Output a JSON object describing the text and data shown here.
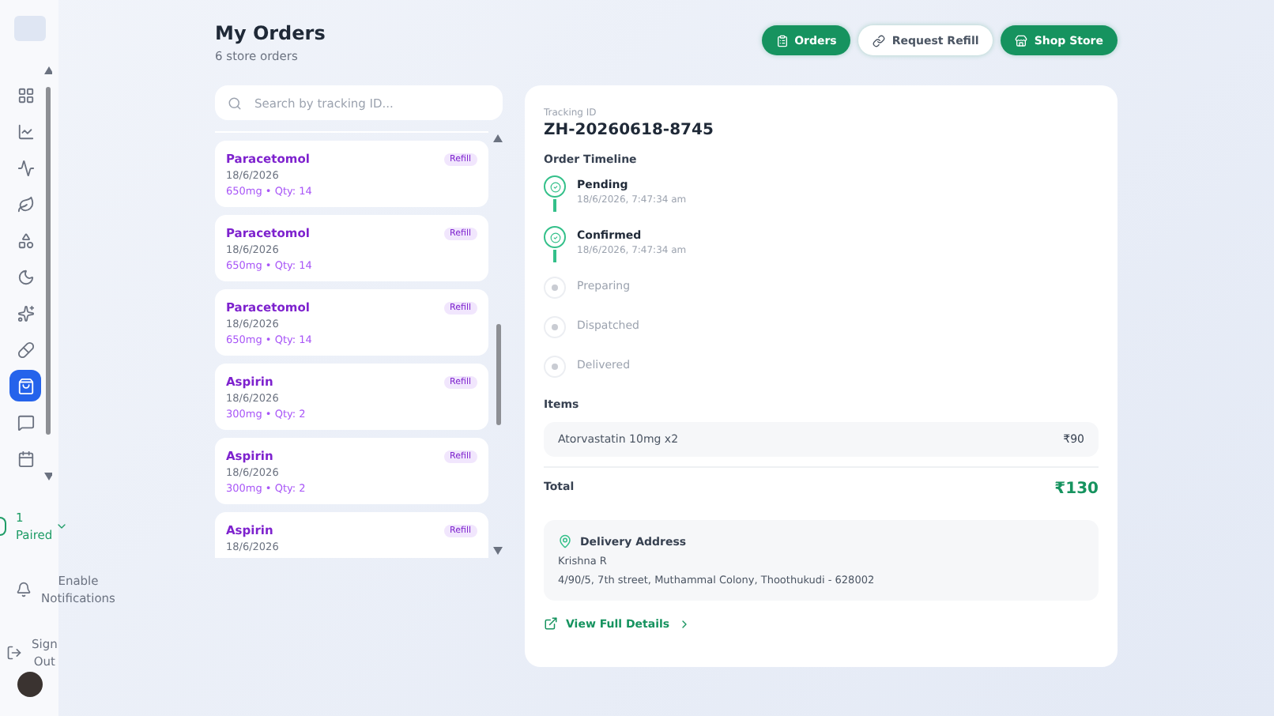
{
  "sidebar": {
    "nav_items": [
      {
        "selected": false
      },
      {
        "selected": false
      },
      {
        "selected": false
      },
      {
        "selected": false
      },
      {
        "selected": false
      },
      {
        "selected": false
      },
      {
        "selected": false
      },
      {
        "selected": false
      },
      {
        "selected": true
      },
      {
        "selected": false
      },
      {
        "selected": false
      }
    ],
    "paired": {
      "count": "1",
      "label": "Paired"
    },
    "notifications": {
      "label": "Enable Notifications"
    },
    "sign_out": {
      "label": "Sign Out"
    }
  },
  "header": {
    "title": "My Orders",
    "subtitle": "6 store orders",
    "buttons": [
      {
        "label": "Orders",
        "kind": "primary"
      },
      {
        "label": "Request Refill",
        "kind": "secondary"
      },
      {
        "label": "Shop Store",
        "kind": "primary"
      }
    ]
  },
  "search": {
    "placeholder": "Search by tracking ID..."
  },
  "orders": [
    {
      "name": "Paracetomol",
      "badge": "Refill",
      "date": "18/6/2026",
      "detail": "650mg • Qty: 14"
    },
    {
      "name": "Paracetomol",
      "badge": "Refill",
      "date": "18/6/2026",
      "detail": "650mg • Qty: 14"
    },
    {
      "name": "Paracetomol",
      "badge": "Refill",
      "date": "18/6/2026",
      "detail": "650mg • Qty: 14"
    },
    {
      "name": "Aspirin",
      "badge": "Refill",
      "date": "18/6/2026",
      "detail": "300mg • Qty: 2"
    },
    {
      "name": "Aspirin",
      "badge": "Refill",
      "date": "18/6/2026",
      "detail": "300mg • Qty: 2"
    },
    {
      "name": "Aspirin",
      "badge": "Refill",
      "date": "18/6/2026"
    }
  ],
  "detail": {
    "tracking_label": "Tracking ID",
    "tracking_id": "ZH-20260618-8745",
    "timeline_title": "Order Timeline",
    "timeline": [
      {
        "status": "Pending",
        "time": "18/6/2026, 7:47:34 am",
        "done": true
      },
      {
        "status": "Confirmed",
        "time": "18/6/2026, 7:47:34 am",
        "done": true
      },
      {
        "status": "Preparing",
        "done": false
      },
      {
        "status": "Dispatched",
        "done": false
      },
      {
        "status": "Delivered",
        "done": false
      }
    ],
    "items_title": "Items",
    "items": [
      {
        "name": "Atorvastatin 10mg x2",
        "price": "₹90"
      }
    ],
    "total_label": "Total",
    "total": "₹130",
    "address": {
      "title": "Delivery Address",
      "name": "Krishna R",
      "line": "4/90/5, 7th street, Muthammal Colony, Thoothukudi - 628002"
    },
    "link": "View Full Details"
  }
}
